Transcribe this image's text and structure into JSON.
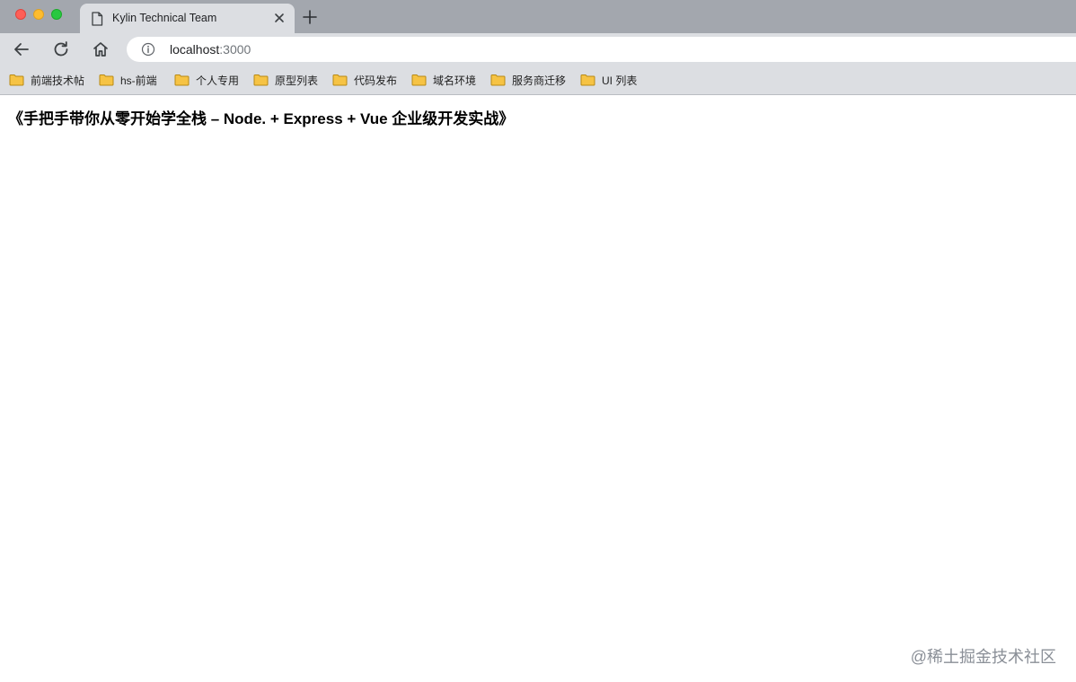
{
  "browser": {
    "tab": {
      "title": "Kylin Technical Team",
      "icon": "document-icon"
    },
    "toolbar": {
      "back_icon": "arrow-left-icon",
      "reload_icon": "reload-icon",
      "home_icon": "home-icon"
    },
    "address": {
      "host": "localhost",
      "port": ":3000",
      "icon": "info-icon"
    },
    "bookmarks": [
      {
        "label": "前端技术帖"
      },
      {
        "label": "hs-前端"
      },
      {
        "label": "个人专用"
      },
      {
        "label": "原型列表"
      },
      {
        "label": "代码发布"
      },
      {
        "label": "域名环境"
      },
      {
        "label": "服务商迁移"
      },
      {
        "label": "UI 列表"
      }
    ]
  },
  "page": {
    "heading": "《手把手带你从零开始学全栈 – Node. + Express + Vue 企业级开发实战》",
    "watermark": "@稀土掘金技术社区"
  },
  "colors": {
    "tabstrip": "#a3a7ae",
    "toolbar": "#dcdee2",
    "folder": "#f6c344"
  }
}
